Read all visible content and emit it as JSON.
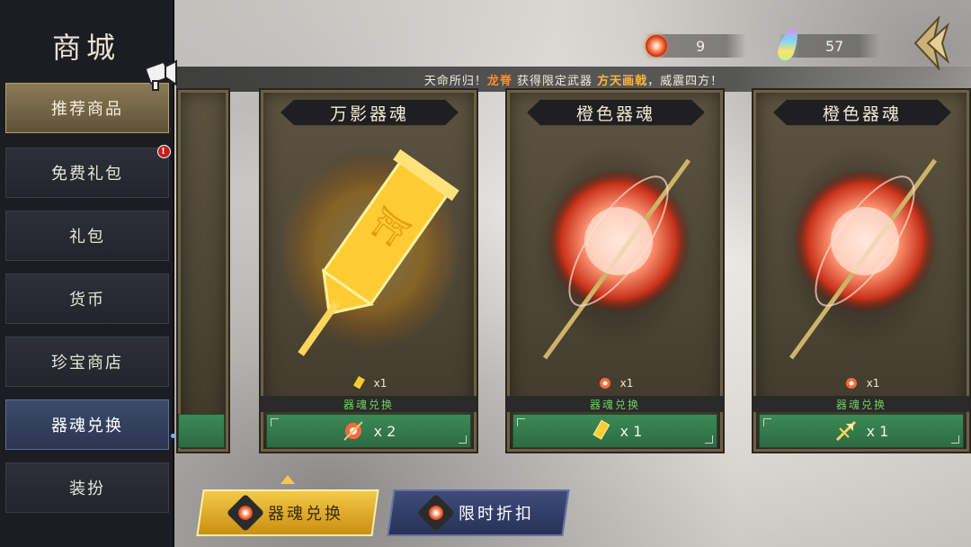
{
  "shop": {
    "title": "商城"
  },
  "sidebar": {
    "items": [
      {
        "label": "推荐商品",
        "state": "gold"
      },
      {
        "label": "免费礼包",
        "badge": "!"
      },
      {
        "label": "礼包"
      },
      {
        "label": "货币"
      },
      {
        "label": "珍宝商店"
      },
      {
        "label": "器魂兑换",
        "state": "active"
      },
      {
        "label": "装扮"
      }
    ]
  },
  "currency": {
    "orb_amount": "9",
    "feather_amount": "57"
  },
  "announcement": {
    "prefix": "天命所归！",
    "player": "龙脊",
    "middle": " 获得限定武器 ",
    "weapon": "方天画戟",
    "suffix": "，威震四方！"
  },
  "cards": [
    {
      "title": "万影器魂",
      "req_qty": "x1",
      "label": "器魂兑换",
      "price": "x 2"
    },
    {
      "title": "橙色器魂",
      "req_qty": "x1",
      "label": "器魂兑换",
      "price": "x 1"
    },
    {
      "title": "橙色器魂",
      "req_qty": "x1",
      "label": "器魂兑换",
      "price": "x 1"
    }
  ],
  "bottom_tabs": [
    {
      "label": "器魂兑换",
      "active": true
    },
    {
      "label": "限时折扣",
      "active": false
    }
  ],
  "colors": {
    "accent_gold": "#f5c947",
    "buy_green": "#3c8a57",
    "label_green": "#6ecf63",
    "highlight_orange": "#ff8b2a"
  }
}
